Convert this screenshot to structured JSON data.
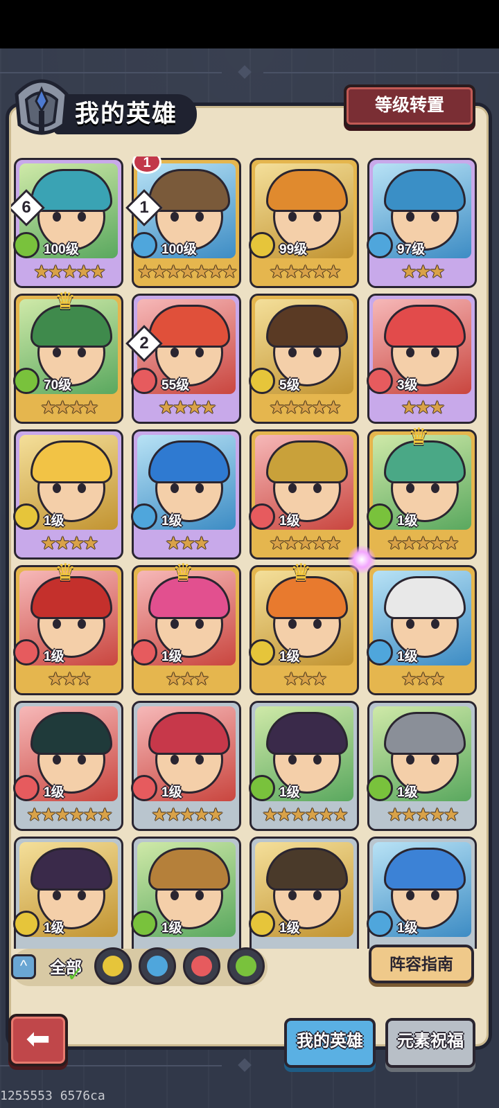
{
  "header": {
    "title": "我的英雄",
    "level_transfer_label": "等级转置"
  },
  "heroes": [
    {
      "level": "100级",
      "element": "nature",
      "stars": "★★★★★",
      "frame": "purple",
      "badge": "6",
      "crown": false
    },
    {
      "level": "100级",
      "element": "water",
      "stars": "★★★★★★★",
      "frame": "gold",
      "badge": "1",
      "rank": "1",
      "crown": false
    },
    {
      "level": "99级",
      "element": "earth",
      "stars": "★★★★★",
      "frame": "gold",
      "crown": false
    },
    {
      "level": "97级",
      "element": "water",
      "stars": "★★★",
      "frame": "purple",
      "crown": false
    },
    {
      "level": "70级",
      "element": "nature",
      "stars": "★★★★",
      "frame": "gold",
      "crown": true
    },
    {
      "level": "55级",
      "element": "fire",
      "stars": "★★★★",
      "frame": "purple",
      "badge": "2",
      "crown": false
    },
    {
      "level": "5级",
      "element": "earth",
      "stars": "★★★★★",
      "frame": "gold",
      "crown": false
    },
    {
      "level": "3级",
      "element": "fire",
      "stars": "★★★",
      "frame": "purple",
      "crown": false
    },
    {
      "level": "1级",
      "element": "earth",
      "stars": "★★★★",
      "frame": "purple",
      "crown": false
    },
    {
      "level": "1级",
      "element": "water",
      "stars": "★★★",
      "frame": "purple",
      "crown": false
    },
    {
      "level": "1级",
      "element": "fire",
      "stars": "★★★★★",
      "frame": "gold",
      "crown": false
    },
    {
      "level": "1级",
      "element": "nature",
      "stars": "★★★★★",
      "frame": "gold",
      "crown": true
    },
    {
      "level": "1级",
      "element": "fire",
      "stars": "★★★",
      "frame": "gold",
      "crown": true
    },
    {
      "level": "1级",
      "element": "fire",
      "stars": "★★★",
      "frame": "gold",
      "crown": true
    },
    {
      "level": "1级",
      "element": "earth",
      "stars": "★★★",
      "frame": "gold",
      "crown": true
    },
    {
      "level": "1级",
      "element": "water",
      "stars": "★★★",
      "frame": "gold",
      "crown": false
    },
    {
      "level": "1级",
      "element": "fire",
      "stars": "★★★★★★",
      "frame": "silver",
      "crown": false
    },
    {
      "level": "1级",
      "element": "fire",
      "stars": "★★★★★",
      "frame": "silver",
      "crown": false
    },
    {
      "level": "1级",
      "element": "nature",
      "stars": "★★★★★★",
      "frame": "silver",
      "crown": false
    },
    {
      "level": "1级",
      "element": "nature",
      "stars": "★★★★★",
      "frame": "silver",
      "crown": false
    },
    {
      "level": "1级",
      "element": "earth",
      "stars": "",
      "frame": "silver",
      "crown": false
    },
    {
      "level": "1级",
      "element": "nature",
      "stars": "",
      "frame": "silver",
      "crown": false
    },
    {
      "level": "1级",
      "element": "earth",
      "stars": "",
      "frame": "silver",
      "crown": false
    },
    {
      "level": "1级",
      "element": "water",
      "stars": "",
      "frame": "silver",
      "crown": false
    }
  ],
  "filters": {
    "all_label": "全部",
    "elements": [
      "earth",
      "water",
      "fire",
      "nature"
    ]
  },
  "guide_label": "阵容指南",
  "tabs": {
    "my_heroes": "我的英雄",
    "element_blessing": "元素祝福"
  },
  "footer_code": "1255553 6576ca",
  "colors": {
    "nature": "#79c23c",
    "water": "#4fa6dc",
    "fire": "#e65b5e",
    "earth": "#e6c53a",
    "frame_purple": "#c8a9ea",
    "frame_gold": "#e5b64e",
    "frame_silver": "#b9c5ce"
  }
}
